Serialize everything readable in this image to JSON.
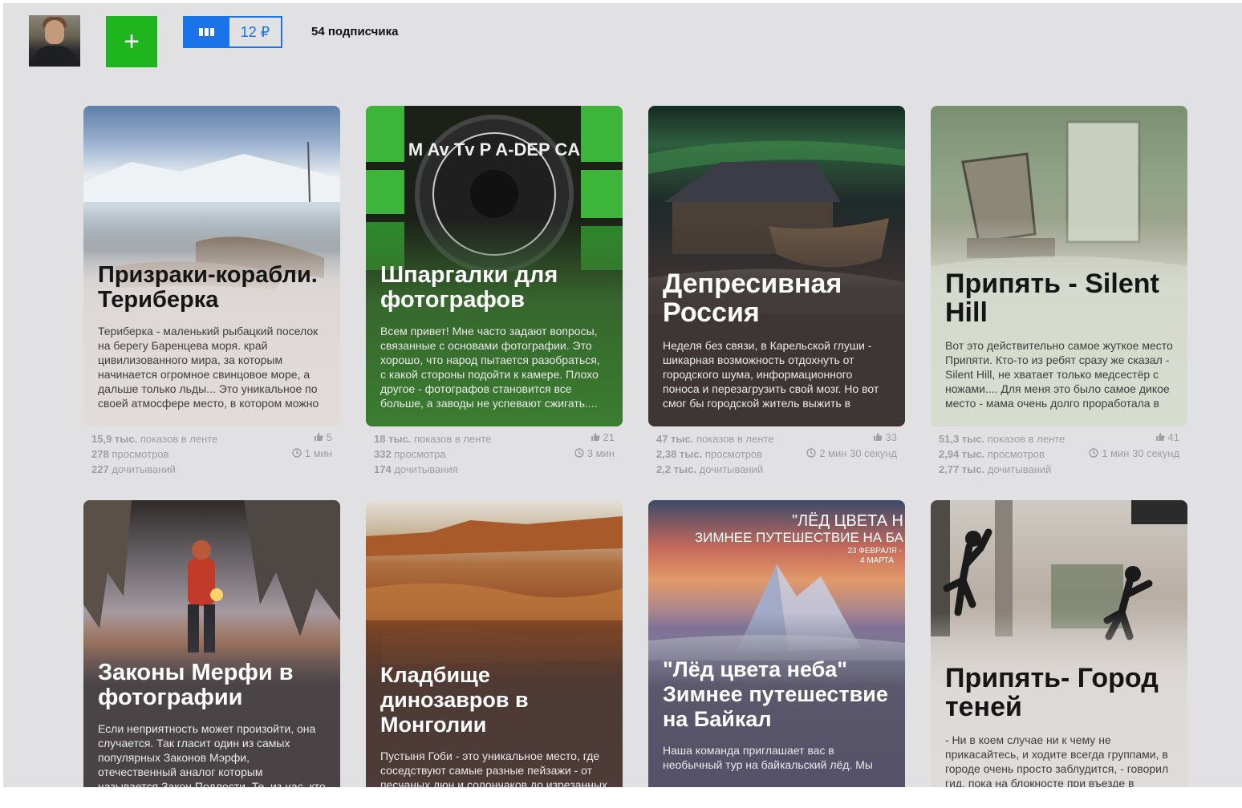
{
  "header": {
    "add_label": "+",
    "donate_amount": "12 ₽",
    "subscribers": "54 подписчика"
  },
  "cards": [
    {
      "title": "Призраки-корабли. Териберка",
      "snippet": "Териберка - маленький рыбацкий поселок на берегу Баренцева моря. край цивилизованного мира, за которым начинается огромное свинцовое море, а дальше только льды... Это уникальное по своей атмосфере место, в котором можно",
      "impressions_value": "15,9 тыс.",
      "impressions_label": "показов в ленте",
      "views_value": "278",
      "views_label": "просмотров",
      "reads_value": "227",
      "reads_label": "дочитываний",
      "likes": "5",
      "read_time": "1 мин"
    },
    {
      "title": "Шпаргалки для фотографов",
      "snippet": "Всем привет! Мне часто задают вопросы, связанные с основами фотографии. Это хорошо, что народ пытается разобраться, с какой стороны подойти к камере. Плохо другое - фотографов становится все больше, а заводы не успевают сжигать....",
      "impressions_value": "18 тыс.",
      "impressions_label": "показов в ленте",
      "views_value": "332",
      "views_label": "просмотра",
      "reads_value": "174",
      "reads_label": "дочитывания",
      "likes": "21",
      "read_time": "3 мин"
    },
    {
      "title": "Депресивная Россия",
      "snippet": "Неделя без связи, в Карельской глуши - шикарная возможность отдохнуть от городского шума, информационного поноса и перезагрузить свой мозг. Но вот смог бы городской житель выжить в",
      "impressions_value": "47 тыс.",
      "impressions_label": "показов в ленте",
      "views_value": "2,38 тыс.",
      "views_label": "просмотров",
      "reads_value": "2,2 тыс.",
      "reads_label": "дочитываний",
      "likes": "33",
      "read_time": "2 мин 30 секунд"
    },
    {
      "title": "Припять - Silent Hill",
      "snippet": "Вот это действительно самое жуткое место Припяти. Кто-то из ребят сразу же сказал - Silent Hill, не хватает только медсестёр с ножами.... Для меня это было самое дикое место - мама очень долго проработала в",
      "impressions_value": "51,3 тыс.",
      "impressions_label": "показов в ленте",
      "views_value": "2,94 тыс.",
      "views_label": "просмотров",
      "reads_value": "2,77 тыс.",
      "reads_label": "дочитываний",
      "likes": "41",
      "read_time": "1 мин 30 секунд"
    },
    {
      "title": "Законы Мерфи в фотографии",
      "snippet": "Если неприятность может произойти, она случается. Так гласит один из самых популярных Законов Мэрфи, отечественный аналог которым называется Закон Подлости. Те, из нас, кто выбрал"
    },
    {
      "title": "Кладбище динозавров в Монголии",
      "snippet": "Пустыня Гоби - это уникальное место, где соседствуют самые разные пейзажи - от песчаных дюн и солончаков до изрезанных"
    },
    {
      "title": "\"Лёд цвета неба\" Зимнее путешествие на Байкал",
      "snippet": "Наша команда приглашает вас в необычный тур на байкальский лёд. Мы отправимся в",
      "overlay_line1": "\"ЛЁД ЦВЕТА Н",
      "overlay_line2": "ЗИМНЕЕ ПУТЕШЕСТВИЕ НА БА",
      "overlay_line3": "23 ФЕВРАЛЯ -",
      "overlay_line4": "4 МАРТА"
    },
    {
      "title": "Припять- Город теней",
      "snippet": "- Ни в коем случае ни к чему не прикасайтесь, и ходите всегда группами, в городе очень просто заблудится, - говорил гид, пока на блокносте при въезде в"
    }
  ],
  "camera_dial_letters": "M Av Tv P A-DEP CA",
  "icons": {
    "likes": "thumbs-up-icon",
    "time": "clock-icon",
    "donate": "bars-icon"
  },
  "colors": {
    "add_button": "#1fb51e",
    "donate_accent": "#1a73e8",
    "page_bg": "#e1e0e2",
    "stats_text": "#9e9ea3"
  }
}
